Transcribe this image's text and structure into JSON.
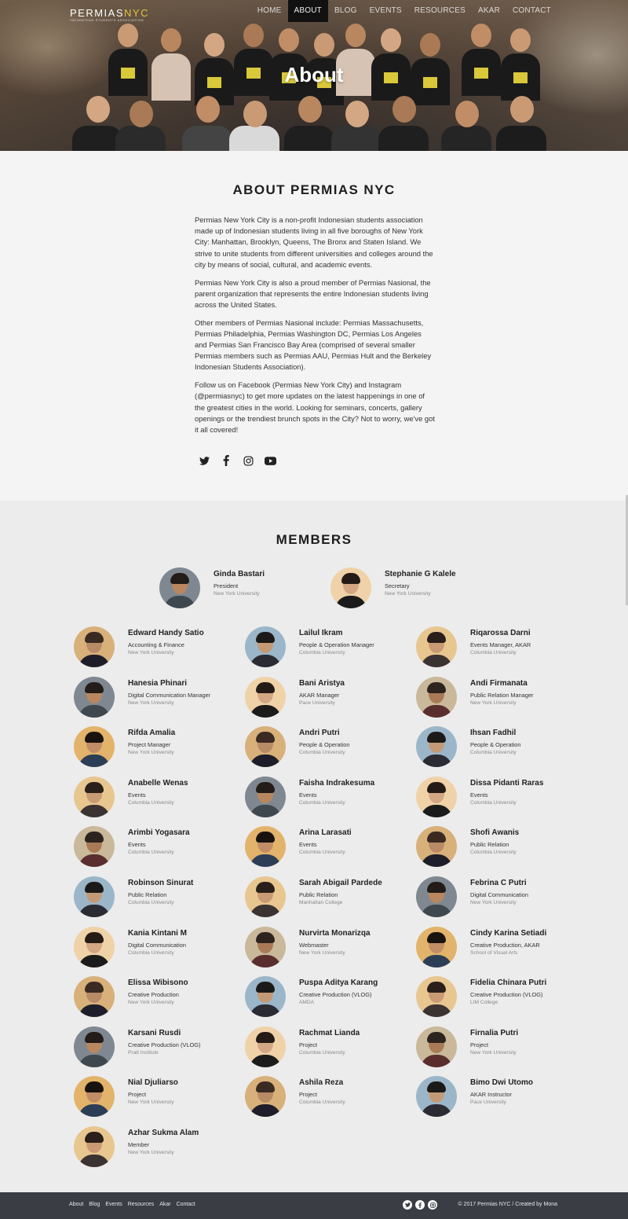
{
  "nav": {
    "logo_main": "PERMIAS",
    "logo_accent": "NYC",
    "logo_sub": "INDONESIAN STUDENTS ASSOCIATION",
    "items": [
      {
        "label": "HOME",
        "active": false
      },
      {
        "label": "ABOUT",
        "active": true
      },
      {
        "label": "BLOG",
        "active": false
      },
      {
        "label": "EVENTS",
        "active": false
      },
      {
        "label": "RESOURCES",
        "active": false
      },
      {
        "label": "AKAR",
        "active": false
      },
      {
        "label": "CONTACT",
        "active": false
      }
    ]
  },
  "hero": {
    "title": "About"
  },
  "about": {
    "heading": "ABOUT PERMIAS NYC",
    "paragraphs": [
      "Permias New York City is a non-profit Indonesian students association made up of Indonesian students living in all five boroughs of New York City: Manhattan, Brooklyn, Queens, The Bronx and Staten Island. We strive to unite students from different universities and colleges around the city by means of social, cultural, and academic events.",
      "Permias New York City is also a proud member of Permias Nasional, the parent organization that represents the entire Indonesian students living across the United States.",
      "Other members of Permias Nasional include: Permias Massachusetts, Permias Philadelphia, Permias Washington DC, Permias Los Angeles and Permias San Francisco Bay Area (comprised of several smaller Permias members such as Permias AAU, Permias Hult and the Berkeley Indonesian Students Association).",
      "Follow us on Facebook (Permias New York City) and Instagram (@permiasnyc) to get more updates on the latest happenings in one of the greatest cities in the world. Looking for seminars, concerts, gallery openings or the trendiest brunch spots in the City? Not to worry, we've got it all covered!"
    ],
    "social_icons": [
      "twitter-icon",
      "facebook-icon",
      "instagram-icon",
      "youtube-icon"
    ]
  },
  "members": {
    "heading": "MEMBERS",
    "leaders": [
      {
        "name": "Ginda Bastari",
        "role": "President",
        "school": "New York University"
      },
      {
        "name": "Stephanie G Kalele",
        "role": "Secretary",
        "school": "New York University"
      }
    ],
    "list": [
      {
        "name": "Edward Handy Satio",
        "role": "Accounting & Finance",
        "school": "New York University"
      },
      {
        "name": "Lailul Ikram",
        "role": "People & Operation Manager",
        "school": "Columbia University"
      },
      {
        "name": "Riqarossa Darni",
        "role": "Events Manager, AKAR",
        "school": "Columbia University"
      },
      {
        "name": "Hanesia Phinari",
        "role": "Digital Communication Manager",
        "school": "New York University"
      },
      {
        "name": "Bani Aristya",
        "role": "AKAR Manager",
        "school": "Pace University"
      },
      {
        "name": "Andi Firmanata",
        "role": "Public Relation Manager",
        "school": "New York University"
      },
      {
        "name": "Rifda Amalia",
        "role": "Project Manager",
        "school": "New York University"
      },
      {
        "name": "Andri Putri",
        "role": "People & Operation",
        "school": "Columbia University"
      },
      {
        "name": "Ihsan Fadhil",
        "role": "People & Operation",
        "school": "Columbia University"
      },
      {
        "name": "Anabelle Wenas",
        "role": "Events",
        "school": "Columbia University"
      },
      {
        "name": "Faisha Indrakesuma",
        "role": "Events",
        "school": "Columbia University"
      },
      {
        "name": "Dissa Pidanti Raras",
        "role": "Events",
        "school": "Columbia University"
      },
      {
        "name": "Arimbi Yogasara",
        "role": "Events",
        "school": "Columbia University"
      },
      {
        "name": "Arina Larasati",
        "role": "Events",
        "school": "Columbia University"
      },
      {
        "name": "Shofi Awanis",
        "role": "Public Relation",
        "school": "Columbia University"
      },
      {
        "name": "Robinson Sinurat",
        "role": "Public Relation",
        "school": "Columbia University"
      },
      {
        "name": "Sarah Abigail Pardede",
        "role": "Public Relation",
        "school": "Manhattan College"
      },
      {
        "name": "Febrina C Putri",
        "role": "Digital Communication",
        "school": "New York University"
      },
      {
        "name": "Kania Kintani M",
        "role": "Digital Communication",
        "school": "Columbia University"
      },
      {
        "name": "Nurvirta Monarizqa",
        "role": "Webmaster",
        "school": "New York University"
      },
      {
        "name": "Cindy Karina Setiadi",
        "role": "Creative Production, AKAR",
        "school": "School of Visual Arts"
      },
      {
        "name": "Elissa Wibisono",
        "role": "Creative Production",
        "school": "New York University"
      },
      {
        "name": "Puspa Aditya Karang",
        "role": "Creative Production (VLOG)",
        "school": "AMDA"
      },
      {
        "name": "Fidelia Chinara Putri",
        "role": "Creative Production (VLOG)",
        "school": "LIM College"
      },
      {
        "name": "Karsani Rusdi",
        "role": "Creative Production (VLOG)",
        "school": "Pratt Institute"
      },
      {
        "name": "Rachmat Lianda",
        "role": "Project",
        "school": "Columbia University"
      },
      {
        "name": "Firnalia Putri",
        "role": "Project",
        "school": "New York University"
      },
      {
        "name": "Nial Djuliarso",
        "role": "Project",
        "school": "New York University"
      },
      {
        "name": "Ashila Reza",
        "role": "Project",
        "school": "Columbia University"
      },
      {
        "name": "Bimo Dwi Utomo",
        "role": "AKAR Instructor",
        "school": "Pace University"
      },
      {
        "name": "Azhar Sukma Alam",
        "role": "Member",
        "school": "New York University"
      }
    ]
  },
  "footer": {
    "links": [
      "About",
      "Blog",
      "Events",
      "Resources",
      "Akar",
      "Contact"
    ],
    "icons": [
      "twitter-icon",
      "facebook-icon",
      "instagram-icon"
    ],
    "copyright": "© 2017 Permias NYC / Created by Mona"
  },
  "colors": {
    "accent": "#e2c443",
    "about_bg": "#f4f4f4",
    "members_bg": "#ececec",
    "footer_bg": "#3a3d44"
  }
}
